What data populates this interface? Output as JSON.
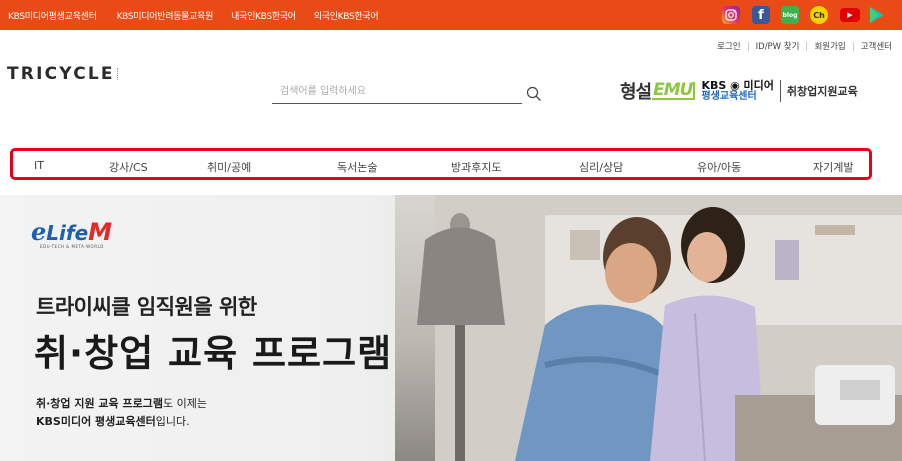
{
  "topbar": {
    "links": [
      "KBS미디어평생교육센터",
      "KBS미디어반려동물교육원",
      "내국인KBS한국어",
      "외국인KBS한국어"
    ],
    "social_icons": [
      {
        "name": "instagram-icon",
        "label": "",
        "color": "#e1306c"
      },
      {
        "name": "facebook-icon",
        "label": "f",
        "color": "#3b5998"
      },
      {
        "name": "blog-icon",
        "label": "blog",
        "color": "#3cb34a"
      },
      {
        "name": "kakao-channel-icon",
        "label": "Ch",
        "color": "#f7d400"
      },
      {
        "name": "youtube-icon",
        "label": "▶",
        "color": "#e00000"
      },
      {
        "name": "play-store-icon",
        "label": "▶",
        "color": "#19c3a5"
      }
    ],
    "accent": "#ea4b16"
  },
  "util": {
    "login": "로그인",
    "find": "ID/PW 찾기",
    "signup": "회원가입",
    "support": "고객센터"
  },
  "header": {
    "logo": "TRICYCLE",
    "search_placeholder": "검색어를 입력하세요",
    "brand_hs": "형설",
    "brand_emu": "EMU",
    "brand_kbs_top": "KBS ◉ 미디어",
    "brand_kbs_bottom": "평생교육센터",
    "brand_job": "취창업지원교육"
  },
  "nav": {
    "items": [
      "IT",
      "강사/CS",
      "취미/공예",
      "독서논술",
      "방과후지도",
      "심리/상담",
      "유아/아동",
      "자기계발"
    ],
    "highlight": "#e8001c"
  },
  "hero": {
    "brand_e": "e",
    "brand_life": "Life",
    "brand_m": "M",
    "brand_sub": "EDU-TECH & META-WORLD",
    "title_line1": "트라이씨클 임직원을 위한",
    "title_line2": "취·창업 교육 프로그램",
    "desc_bold1": "취·창업 지원 교육 프로그램",
    "desc_rest1": "도 이제는",
    "desc_bold2": "KBS미디어 평생교육센터",
    "desc_rest2": "입니다."
  }
}
